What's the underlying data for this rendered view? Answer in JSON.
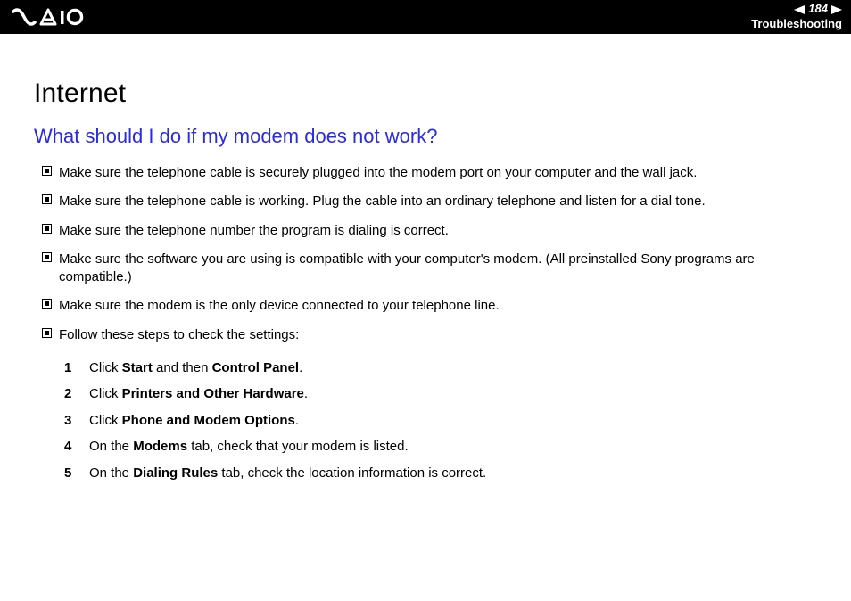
{
  "header": {
    "page_number": "184",
    "section": "Troubleshooting"
  },
  "content": {
    "title": "Internet",
    "question": "What should I do if my modem does not work?",
    "bullets": [
      "Make sure the telephone cable is securely plugged into the modem port on your computer and the wall jack.",
      "Make sure the telephone cable is working. Plug the cable into an ordinary telephone and listen for a dial tone.",
      "Make sure the telephone number the program is dialing is correct.",
      "Make sure the software you are using is compatible with your computer's modem. (All preinstalled Sony programs are compatible.)",
      "Make sure the modem is the only device connected to your telephone line.",
      "Follow these steps to check the settings:"
    ],
    "steps": [
      {
        "num": "1",
        "pre": "Click ",
        "b1": "Start",
        "mid": " and then ",
        "b2": "Control Panel",
        "post": "."
      },
      {
        "num": "2",
        "pre": "Click ",
        "b1": "Printers and Other Hardware",
        "mid": "",
        "b2": "",
        "post": "."
      },
      {
        "num": "3",
        "pre": "Click ",
        "b1": "Phone and Modem Options",
        "mid": "",
        "b2": "",
        "post": "."
      },
      {
        "num": "4",
        "pre": "On the ",
        "b1": "Modems",
        "mid": " tab, check that your modem is listed.",
        "b2": "",
        "post": ""
      },
      {
        "num": "5",
        "pre": "On the ",
        "b1": "Dialing Rules",
        "mid": " tab, check the location information is correct.",
        "b2": "",
        "post": ""
      }
    ]
  }
}
